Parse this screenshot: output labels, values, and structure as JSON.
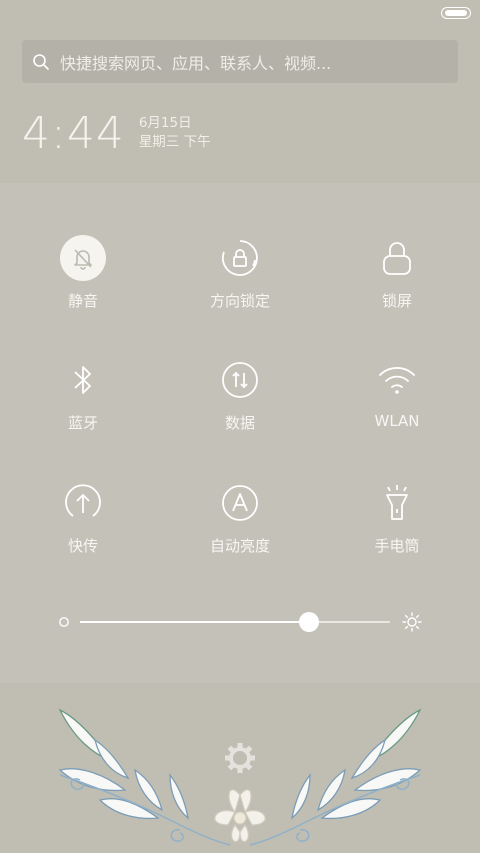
{
  "status_bar": {
    "battery_icon": "battery-icon"
  },
  "search": {
    "placeholder": "快捷搜索网页、应用、联系人、视频..."
  },
  "clock": {
    "time": "4:44",
    "date": "6月15日",
    "weekday": "星期三 下午"
  },
  "toggles": [
    {
      "label": "静音",
      "icon": "bell-off-icon",
      "active": true
    },
    {
      "label": "方向锁定",
      "icon": "rotation-lock-icon",
      "active": false
    },
    {
      "label": "锁屏",
      "icon": "lock-icon",
      "active": false
    },
    {
      "label": "蓝牙",
      "icon": "bluetooth-icon",
      "active": false
    },
    {
      "label": "数据",
      "icon": "data-arrows-icon",
      "active": false
    },
    {
      "label": "WLAN",
      "icon": "wifi-icon",
      "active": false
    },
    {
      "label": "快传",
      "icon": "upload-icon",
      "active": false
    },
    {
      "label": "自动亮度",
      "icon": "auto-brightness-icon",
      "active": false
    },
    {
      "label": "手电筒",
      "icon": "flashlight-icon",
      "active": false
    }
  ],
  "brightness": {
    "level": 0.74
  },
  "colors": {
    "background": "#c0beb3",
    "panel": "#c3c1b8",
    "accent": "#ffffff"
  }
}
